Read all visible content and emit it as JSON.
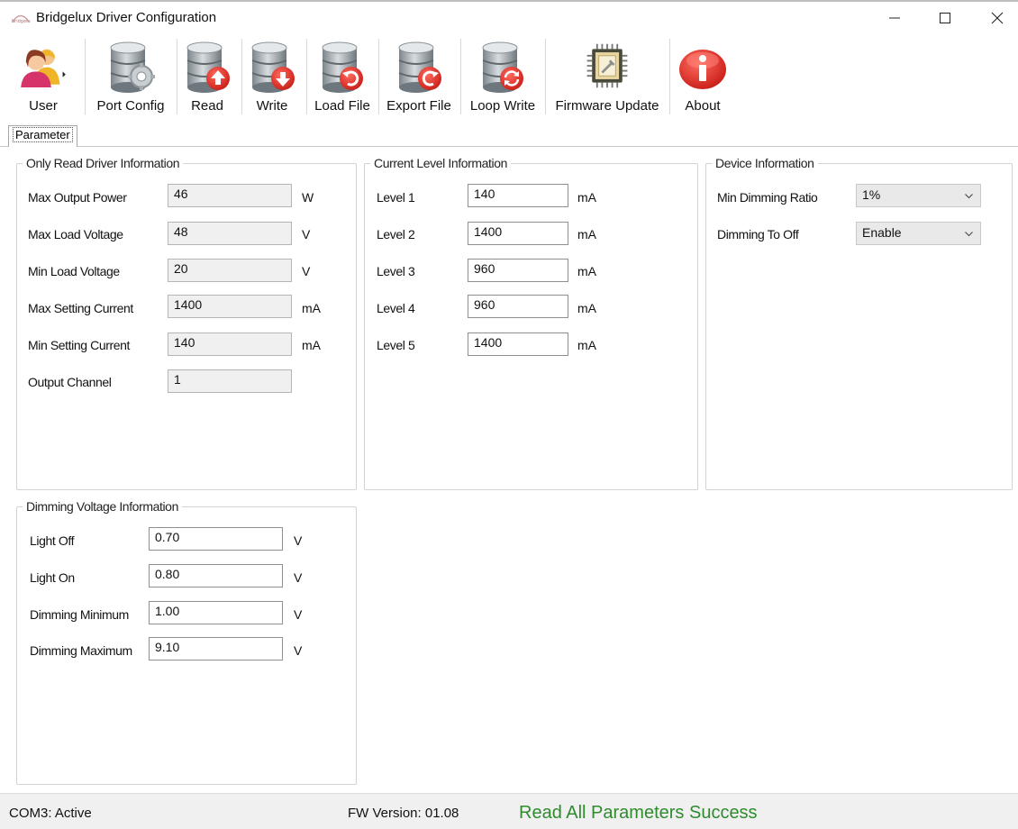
{
  "window": {
    "title": "Bridgelux Driver Configuration",
    "controls": [
      "minimize",
      "maximize",
      "close"
    ]
  },
  "toolbar": {
    "items": [
      {
        "label": "User",
        "icon": "users-icon"
      },
      {
        "label": "Port Config",
        "icon": "database-gear-icon"
      },
      {
        "label": "Read",
        "icon": "database-upload-icon"
      },
      {
        "label": "Write",
        "icon": "database-download-icon"
      },
      {
        "label": "Load File",
        "icon": "database-load-icon"
      },
      {
        "label": "Export File",
        "icon": "database-export-icon"
      },
      {
        "label": "Loop Write",
        "icon": "database-loop-icon"
      },
      {
        "label": "Firmware  Update",
        "icon": "chip-icon"
      },
      {
        "label": "About",
        "icon": "info-icon"
      }
    ]
  },
  "tabs": [
    {
      "label": "Parameter",
      "active": true
    }
  ],
  "driver_info": {
    "title": "Only Read Driver Information",
    "rows": [
      {
        "label": "Max Output Power",
        "value": "46",
        "unit": "W"
      },
      {
        "label": "Max Load Voltage",
        "value": "48",
        "unit": "V"
      },
      {
        "label": "Min Load Voltage",
        "value": "20",
        "unit": "V"
      },
      {
        "label": "Max Setting Current",
        "value": "1400",
        "unit": "mA"
      },
      {
        "label": "Min Setting Current",
        "value": "140",
        "unit": "mA"
      },
      {
        "label": "Output Channel",
        "value": "1",
        "unit": ""
      }
    ]
  },
  "current_level": {
    "title": "Current Level Information",
    "rows": [
      {
        "label": "Level 1",
        "value": "140",
        "unit": "mA"
      },
      {
        "label": "Level 2",
        "value": "1400",
        "unit": "mA"
      },
      {
        "label": "Level 3",
        "value": "960",
        "unit": "mA"
      },
      {
        "label": "Level 4",
        "value": "960",
        "unit": "mA"
      },
      {
        "label": "Level 5",
        "value": "1400",
        "unit": "mA"
      }
    ]
  },
  "device_info": {
    "title": "Device Information",
    "rows": [
      {
        "label": "Min Dimming Ratio",
        "value": "1%"
      },
      {
        "label": "Dimming To Off",
        "value": "Enable"
      }
    ]
  },
  "dimming_voltage": {
    "title": "Dimming Voltage Information",
    "rows": [
      {
        "label": "Light Off",
        "value": "0.70",
        "unit": "V"
      },
      {
        "label": "Light On",
        "value": "0.80",
        "unit": "V"
      },
      {
        "label": "Dimming Minimum",
        "value": "1.00",
        "unit": "V"
      },
      {
        "label": "Dimming Maximum",
        "value": "9.10",
        "unit": "V"
      }
    ]
  },
  "status": {
    "port": "COM3: Active",
    "fw_version": "FW Version: 01.08",
    "message": "Read All Parameters Success",
    "message_color": "#2e8b2e"
  },
  "colors": {
    "db_gray": "#9aa3a8",
    "arrow_red": "#e0332b",
    "info_red": "#d9262b"
  }
}
